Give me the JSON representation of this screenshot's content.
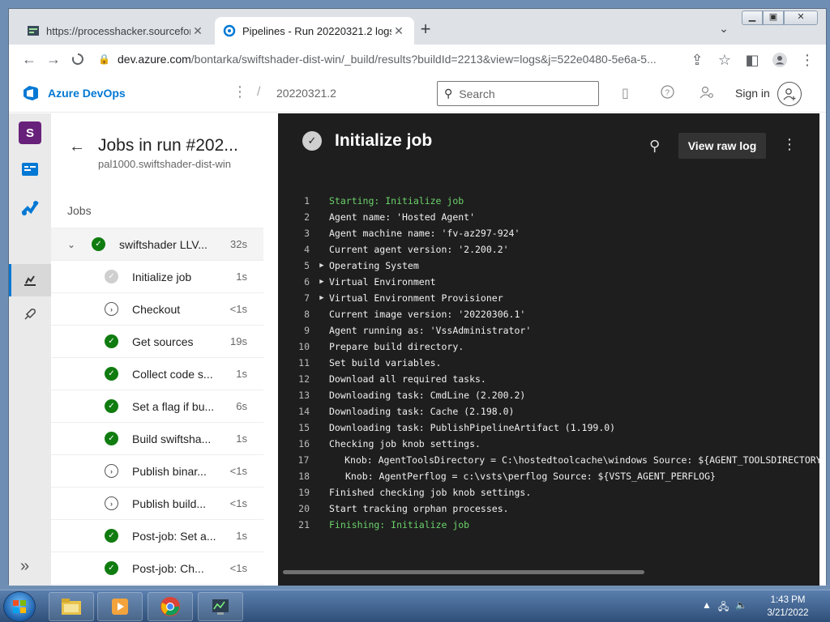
{
  "browser": {
    "tabs": [
      {
        "title": "https://processhacker.sourceforge",
        "close": "✕"
      },
      {
        "title": "Pipelines - Run 20220321.2 logs",
        "close": "✕"
      }
    ],
    "new_tab": "+",
    "url_host": "dev.azure.com",
    "url_path": "/bontarka/swiftshader-dist-win/_build/results?buildId=2213&view=logs&j=522e0480-5e6a-5..."
  },
  "header": {
    "product": "Azure DevOps",
    "breadcrumb_build": "20220321.2",
    "search_placeholder": "Search",
    "sign_in": "Sign in"
  },
  "nav": {
    "project_initial": "S"
  },
  "jobs_panel": {
    "title": "Jobs in run #202...",
    "subtitle": "pal1000.swiftshader-dist-win",
    "section": "Jobs",
    "parent_job": {
      "label": "swiftshader LLV...",
      "duration": "32s"
    },
    "steps": [
      {
        "label": "Initialize job",
        "duration": "1s",
        "status": "pending"
      },
      {
        "label": "Checkout",
        "duration": "<1s",
        "status": "skip"
      },
      {
        "label": "Get sources",
        "duration": "19s",
        "status": "ok"
      },
      {
        "label": "Collect code s...",
        "duration": "1s",
        "status": "ok"
      },
      {
        "label": "Set a flag if bu...",
        "duration": "6s",
        "status": "ok"
      },
      {
        "label": "Build swiftsha...",
        "duration": "1s",
        "status": "ok"
      },
      {
        "label": "Publish binar...",
        "duration": "<1s",
        "status": "skip"
      },
      {
        "label": "Publish build...",
        "duration": "<1s",
        "status": "skip"
      },
      {
        "label": "Post-job: Set a...",
        "duration": "1s",
        "status": "ok"
      },
      {
        "label": "Post-job: Ch...",
        "duration": "<1s",
        "status": "ok"
      }
    ]
  },
  "log_panel": {
    "title": "Initialize job",
    "view_raw": "View raw log",
    "lines": [
      {
        "n": "1",
        "text": "Starting: Initialize job",
        "green": true
      },
      {
        "n": "2",
        "text": "Agent name: 'Hosted Agent'"
      },
      {
        "n": "3",
        "text": "Agent machine name: 'fv-az297-924'"
      },
      {
        "n": "4",
        "text": "Current agent version: '2.200.2'"
      },
      {
        "n": "5",
        "text": "Operating System",
        "toggle": true
      },
      {
        "n": "6",
        "text": "Virtual Environment",
        "toggle": true
      },
      {
        "n": "7",
        "text": "Virtual Environment Provisioner",
        "toggle": true
      },
      {
        "n": "8",
        "text": "Current image version: '20220306.1'"
      },
      {
        "n": "9",
        "text": "Agent running as: 'VssAdministrator'"
      },
      {
        "n": "10",
        "text": "Prepare build directory."
      },
      {
        "n": "11",
        "text": "Set build variables."
      },
      {
        "n": "12",
        "text": "Download all required tasks."
      },
      {
        "n": "13",
        "text": "Downloading task: CmdLine (2.200.2)"
      },
      {
        "n": "14",
        "text": "Downloading task: Cache (2.198.0)"
      },
      {
        "n": "15",
        "text": "Downloading task: PublishPipelineArtifact (1.199.0)"
      },
      {
        "n": "16",
        "text": "Checking job knob settings."
      },
      {
        "n": "17",
        "text": "Knob: AgentToolsDirectory = C:\\hostedtoolcache\\windows Source: ${AGENT_TOOLSDIRECTORY}",
        "indent": true
      },
      {
        "n": "18",
        "text": "Knob: AgentPerflog = c:\\vsts\\perflog Source: ${VSTS_AGENT_PERFLOG}",
        "indent": true
      },
      {
        "n": "19",
        "text": "Finished checking job knob settings."
      },
      {
        "n": "20",
        "text": "Start tracking orphan processes."
      },
      {
        "n": "21",
        "text": "Finishing: Initialize job",
        "green": true
      }
    ]
  },
  "taskbar": {
    "time": "1:43 PM",
    "date": "3/21/2022"
  }
}
